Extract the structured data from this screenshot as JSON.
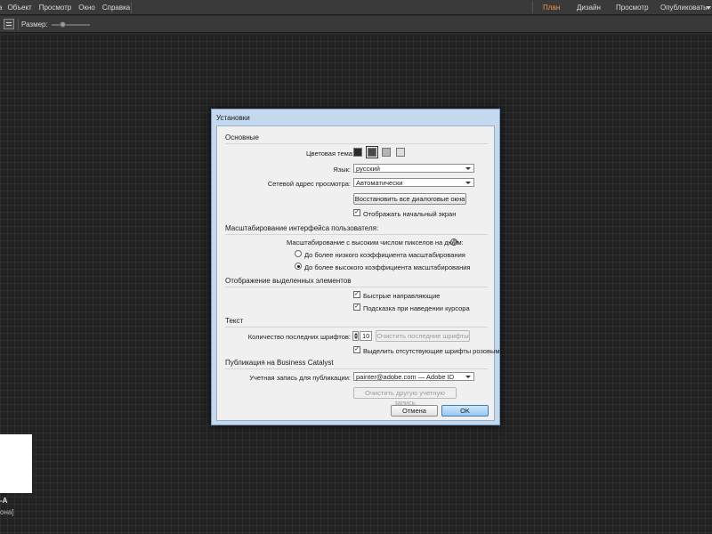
{
  "menubar": {
    "items": [
      "a",
      "Объект",
      "Просмотр",
      "Окно",
      "Справка"
    ],
    "workspaces": {
      "plan": "План",
      "design": "Дизайн",
      "preview": "Просмотр",
      "publish": "Опубликовать"
    },
    "active_workspace": "План"
  },
  "toolbar": {
    "size_label": "Размер:",
    "slider_level": 0.25
  },
  "canvas": {
    "page_name": "-A",
    "page_sub": "она]"
  },
  "dialog": {
    "title": "Установки",
    "general": {
      "section": "Основные",
      "theme_label": "Цветовая тема:",
      "theme_swatches": [
        "#2a2a2a",
        "#4a4a4a",
        "#b4b4b4",
        "#dcdcdc"
      ],
      "language_label": "Язык:",
      "language_value": "русский",
      "preview_label": "Сетевой адрес просмотра:",
      "preview_value": "Автоматически",
      "restore_button": "Восстановить все диалоговые окна",
      "show_start_label": "Отображать начальный экран"
    },
    "scaling": {
      "section": "Масштабирование интерфейса пользователя:",
      "hidpi_label": "Масштабирование с высоким числом пикселов на дюйм:",
      "option_low": "До более низкого коэффициента масштабирования",
      "option_high": "До более высокого коэффициента масштабирования"
    },
    "selection": {
      "section": "Отображение выделенных элементов",
      "smart_guides": "Быстрые направляющие",
      "hover_hint": "Подсказка при наведении курсора"
    },
    "text": {
      "section": "Текст",
      "recent_fonts_label": "Количество последних шрифтов:",
      "recent_fonts_value": "10",
      "clear_fonts_button": "Очистить последние шрифты",
      "highlight_missing": "Выделить отсутствующие шрифты розовым"
    },
    "publishing": {
      "section": "Публикация на Business Catalyst",
      "account_label": "Учетная запись для публикации:",
      "account_value": "painter@adobe.com — Adobe ID",
      "clear_account_button": "Очистить другую учетную запись"
    },
    "cancel_button": "Отмена",
    "ok_button": "OK"
  }
}
